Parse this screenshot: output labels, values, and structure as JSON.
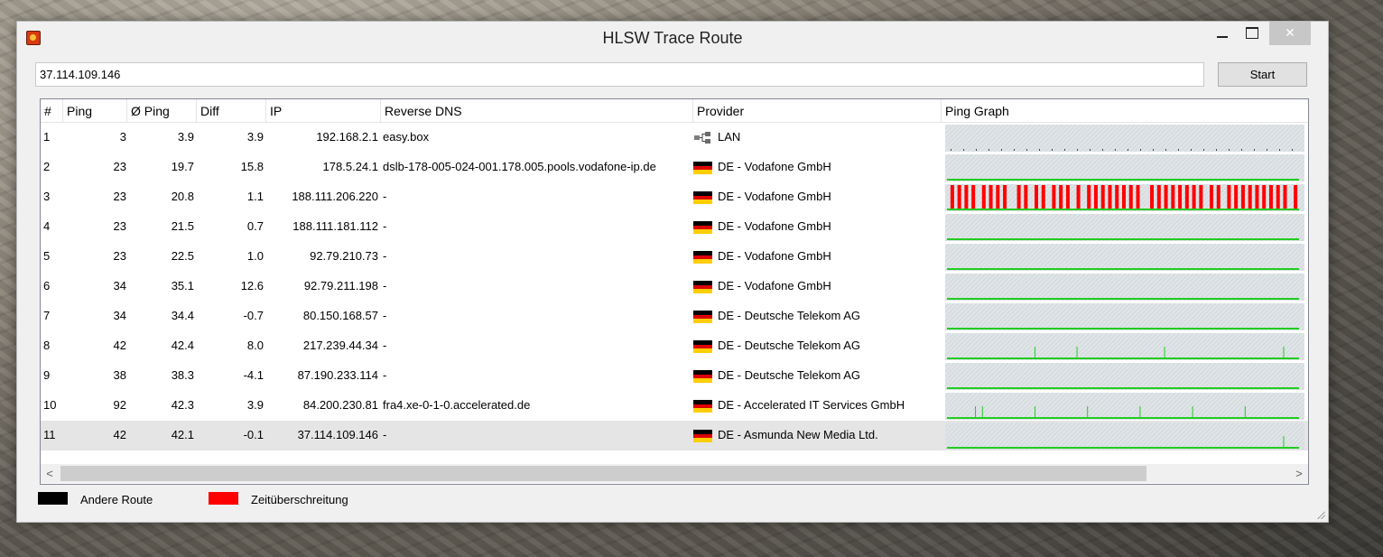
{
  "window": {
    "title": "HLSW Trace Route",
    "close_glyph": "✕"
  },
  "address": {
    "value": "37.114.109.146"
  },
  "start_label": "Start",
  "columns": [
    "#",
    "Ping",
    "Ø Ping",
    "Diff",
    "IP",
    "Reverse DNS",
    "Provider",
    "Ping Graph"
  ],
  "rows": [
    {
      "num": "1",
      "ping": "3",
      "avg": "3.9",
      "diff": "3.9",
      "ip": "192.168.2.1",
      "dns": "easy.box",
      "icon": "lan-icon",
      "provider": "LAN",
      "graph": {
        "spikes": [],
        "timeouts": []
      }
    },
    {
      "num": "2",
      "ping": "23",
      "avg": "19.7",
      "diff": "15.8",
      "ip": "178.5.24.1",
      "dns": "dslb-178-005-024-001.178.005.pools.vodafone-ip.de",
      "icon": "germany-flag-icon",
      "provider": "DE - Vodafone GmbH",
      "graph": {
        "spikes": [],
        "timeouts": []
      }
    },
    {
      "num": "3",
      "ping": "23",
      "avg": "20.8",
      "diff": "1.1",
      "ip": "188.111.206.220",
      "dns": "-",
      "icon": "germany-flag-icon",
      "provider": "DE - Vodafone GmbH",
      "graph": {
        "spikes": [],
        "timeouts": [
          0.01,
          0.03,
          0.05,
          0.07,
          0.1,
          0.12,
          0.14,
          0.16,
          0.2,
          0.22,
          0.25,
          0.27,
          0.3,
          0.32,
          0.34,
          0.37,
          0.4,
          0.42,
          0.44,
          0.46,
          0.48,
          0.5,
          0.52,
          0.54,
          0.58,
          0.6,
          0.62,
          0.64,
          0.66,
          0.68,
          0.7,
          0.72,
          0.75,
          0.77,
          0.8,
          0.82,
          0.84,
          0.86,
          0.88,
          0.9,
          0.92,
          0.94,
          0.96,
          0.99
        ]
      }
    },
    {
      "num": "4",
      "ping": "23",
      "avg": "21.5",
      "diff": "0.7",
      "ip": "188.111.181.112",
      "dns": "-",
      "icon": "germany-flag-icon",
      "provider": "DE - Vodafone GmbH",
      "graph": {
        "spikes": [],
        "timeouts": []
      }
    },
    {
      "num": "5",
      "ping": "23",
      "avg": "22.5",
      "diff": "1.0",
      "ip": "92.79.210.73",
      "dns": "-",
      "icon": "germany-flag-icon",
      "provider": "DE - Vodafone GmbH",
      "graph": {
        "spikes": [],
        "timeouts": []
      }
    },
    {
      "num": "6",
      "ping": "34",
      "avg": "35.1",
      "diff": "12.6",
      "ip": "92.79.211.198",
      "dns": "-",
      "icon": "germany-flag-icon",
      "provider": "DE - Vodafone GmbH",
      "graph": {
        "spikes": [],
        "timeouts": []
      }
    },
    {
      "num": "7",
      "ping": "34",
      "avg": "34.4",
      "diff": "-0.7",
      "ip": "80.150.168.57",
      "dns": "-",
      "icon": "germany-flag-icon",
      "provider": "DE - Deutsche Telekom AG",
      "graph": {
        "spikes": [],
        "timeouts": []
      }
    },
    {
      "num": "8",
      "ping": "42",
      "avg": "42.4",
      "diff": "8.0",
      "ip": "217.239.44.34",
      "dns": "-",
      "icon": "germany-flag-icon",
      "provider": "DE - Deutsche Telekom AG",
      "graph": {
        "spikes": [
          0.25,
          0.37,
          0.62,
          0.96
        ],
        "timeouts": []
      }
    },
    {
      "num": "9",
      "ping": "38",
      "avg": "38.3",
      "diff": "-4.1",
      "ip": "87.190.233.114",
      "dns": "-",
      "icon": "germany-flag-icon",
      "provider": "DE - Deutsche Telekom AG",
      "graph": {
        "spikes": [],
        "timeouts": []
      }
    },
    {
      "num": "10",
      "ping": "92",
      "avg": "42.3",
      "diff": "3.9",
      "ip": "84.200.230.81",
      "dns": "fra4.xe-0-1-0.accelerated.de",
      "icon": "germany-flag-icon",
      "provider": "DE - Accelerated IT Services GmbH",
      "graph": {
        "spikes": [
          0.08,
          0.1,
          0.25,
          0.4,
          0.55,
          0.7,
          0.85
        ],
        "timeouts": []
      }
    },
    {
      "num": "11",
      "ping": "42",
      "avg": "42.1",
      "diff": "-0.1",
      "ip": "37.114.109.146",
      "dns": "-",
      "icon": "germany-flag-icon",
      "provider": "DE - Asmunda New Media Ltd.",
      "graph": {
        "spikes": [
          0.96
        ],
        "timeouts": []
      }
    }
  ],
  "selected_row": "11",
  "scroll": {
    "left_arrow": "<",
    "right_arrow": ">"
  },
  "legend": [
    {
      "label": "Andere Route",
      "color": "#000000"
    },
    {
      "label": "Zeitüberschreitung",
      "color": "#ff0000"
    }
  ],
  "colors": {
    "graph_ok": "#22cc22",
    "graph_timeout": "#ff0000",
    "graph_bg": "#dfe4e7"
  }
}
